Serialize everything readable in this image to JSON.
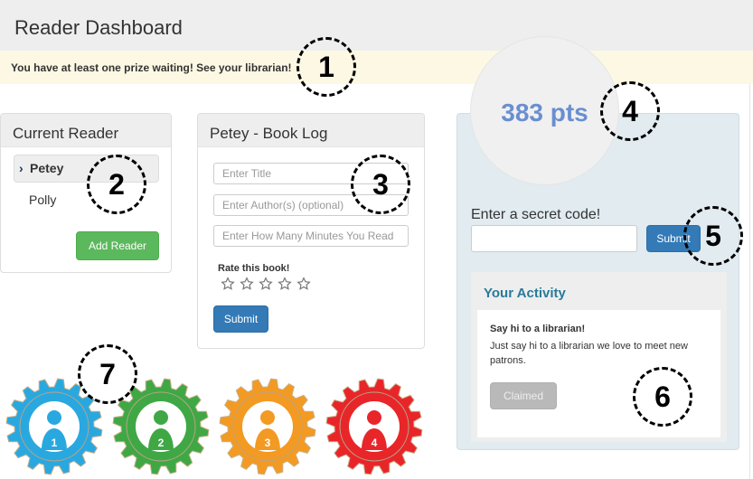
{
  "header": {
    "title": "Reader Dashboard"
  },
  "alert": {
    "message": "You have at least one prize waiting! See your librarian!"
  },
  "reader_panel": {
    "title": "Current Reader",
    "readers": [
      {
        "name": "Petey",
        "active": true,
        "icon": "chevron-right-icon"
      },
      {
        "name": "Polly",
        "active": false
      }
    ],
    "add_button": "Add Reader"
  },
  "book_log": {
    "title": "Petey - Book Log",
    "title_placeholder": "Enter Title",
    "author_placeholder": "Enter Author(s) (optional)",
    "minutes_placeholder": "Enter How Many Minutes You Read",
    "rate_label": "Rate this book!",
    "rating": 0,
    "rating_max": 5,
    "submit": "Submit"
  },
  "points": {
    "value": "383 pts"
  },
  "secret_code": {
    "label": "Enter a secret code!",
    "value": "",
    "submit": "Submit"
  },
  "activity": {
    "title": "Your Activity",
    "items": [
      {
        "title": "Say hi to a librarian!",
        "description": "Just say hi to a librarian  we love to meet new patrons.",
        "button": "Claimed"
      }
    ]
  },
  "badges": [
    {
      "level": "1",
      "color": "#29a8e0",
      "icon": "reader-silhouette-badge-icon"
    },
    {
      "level": "2",
      "color": "#3fa845",
      "icon": "reader-raising-hand-badge-icon"
    },
    {
      "level": "3",
      "color": "#f39a22",
      "icon": "reader-at-desk-badge-icon"
    },
    {
      "level": "4",
      "color": "#e8262a",
      "icon": "reader-at-desk-badge-icon"
    }
  ],
  "callouts": [
    "1",
    "2",
    "3",
    "4",
    "5",
    "6",
    "7"
  ]
}
